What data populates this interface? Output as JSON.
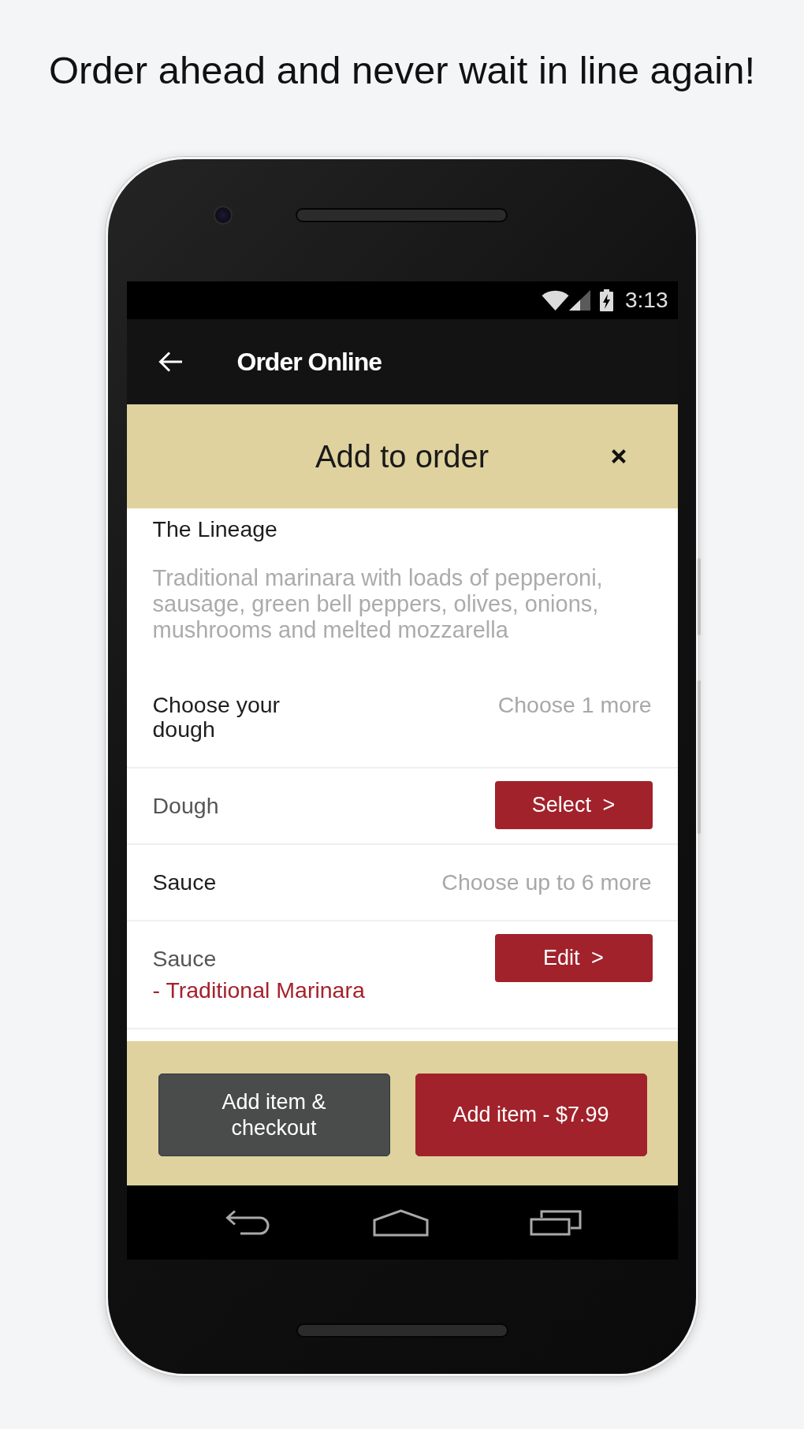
{
  "headline": "Order ahead and never wait in line again!",
  "status_bar": {
    "time": "3:13"
  },
  "app_bar": {
    "title": "Order Online"
  },
  "dialog": {
    "title": "Add to order"
  },
  "item": {
    "name": "The Lineage",
    "description": "Traditional marinara with loads of pepperoni, sausage, green bell peppers, olives, onions, mushrooms and melted mozzarella"
  },
  "rows": [
    {
      "kind": "group",
      "label": "Choose your dough",
      "hint": "Choose 1 more"
    },
    {
      "kind": "option",
      "label": "Dough",
      "button": "Select >"
    },
    {
      "kind": "group",
      "label": "Sauce",
      "hint": "Choose up to 6 more"
    },
    {
      "kind": "option",
      "label": "Sauce",
      "selection": "- Traditional Marinara",
      "button": "Edit >"
    }
  ],
  "actions": [
    {
      "kind": "secondary",
      "label": "Add item & checkout"
    },
    {
      "kind": "primary",
      "label": "Add item - $7.99"
    }
  ]
}
